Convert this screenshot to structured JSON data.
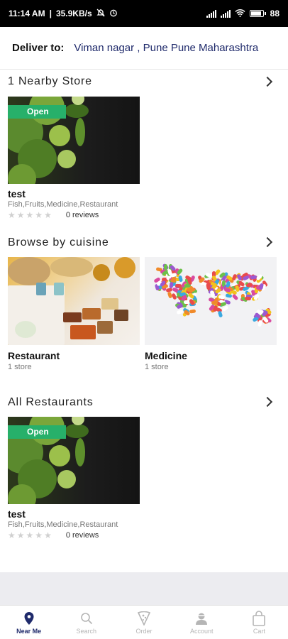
{
  "status_bar": {
    "time": "11:14 AM",
    "speed": "35.9KB/s",
    "battery": "88",
    "battery_pct": 88
  },
  "header": {
    "deliver_label": "Deliver to:",
    "address": "Viman nagar , Pune Pune Maharashtra"
  },
  "nearby": {
    "title": "1 Nearby Store",
    "store": {
      "badge": "Open",
      "name": "test",
      "categories": "Fish,Fruits,Medicine,Restaurant",
      "reviews": "0 reviews",
      "rating": 0
    }
  },
  "cuisine": {
    "title": "Browse by cuisine",
    "items": [
      {
        "name": "Restaurant",
        "count": "1 store"
      },
      {
        "name": "Medicine",
        "count": "1 store"
      }
    ]
  },
  "restaurants": {
    "title": "All Restaurants",
    "store": {
      "badge": "Open",
      "name": "test",
      "categories": "Fish,Fruits,Medicine,Restaurant",
      "reviews": "0 reviews",
      "rating": 0
    }
  },
  "tabs": [
    {
      "label": "Near Me",
      "icon": "location-pin-icon",
      "active": true
    },
    {
      "label": "Search",
      "icon": "search-icon",
      "active": false
    },
    {
      "label": "Order",
      "icon": "pizza-icon",
      "active": false
    },
    {
      "label": "Account",
      "icon": "user-icon",
      "active": false
    },
    {
      "label": "Cart",
      "icon": "bag-icon",
      "active": false
    }
  ],
  "colors": {
    "accent": "#1f2a6b",
    "open_badge": "#27b06a",
    "inactive_tab": "#b5b5b5"
  }
}
